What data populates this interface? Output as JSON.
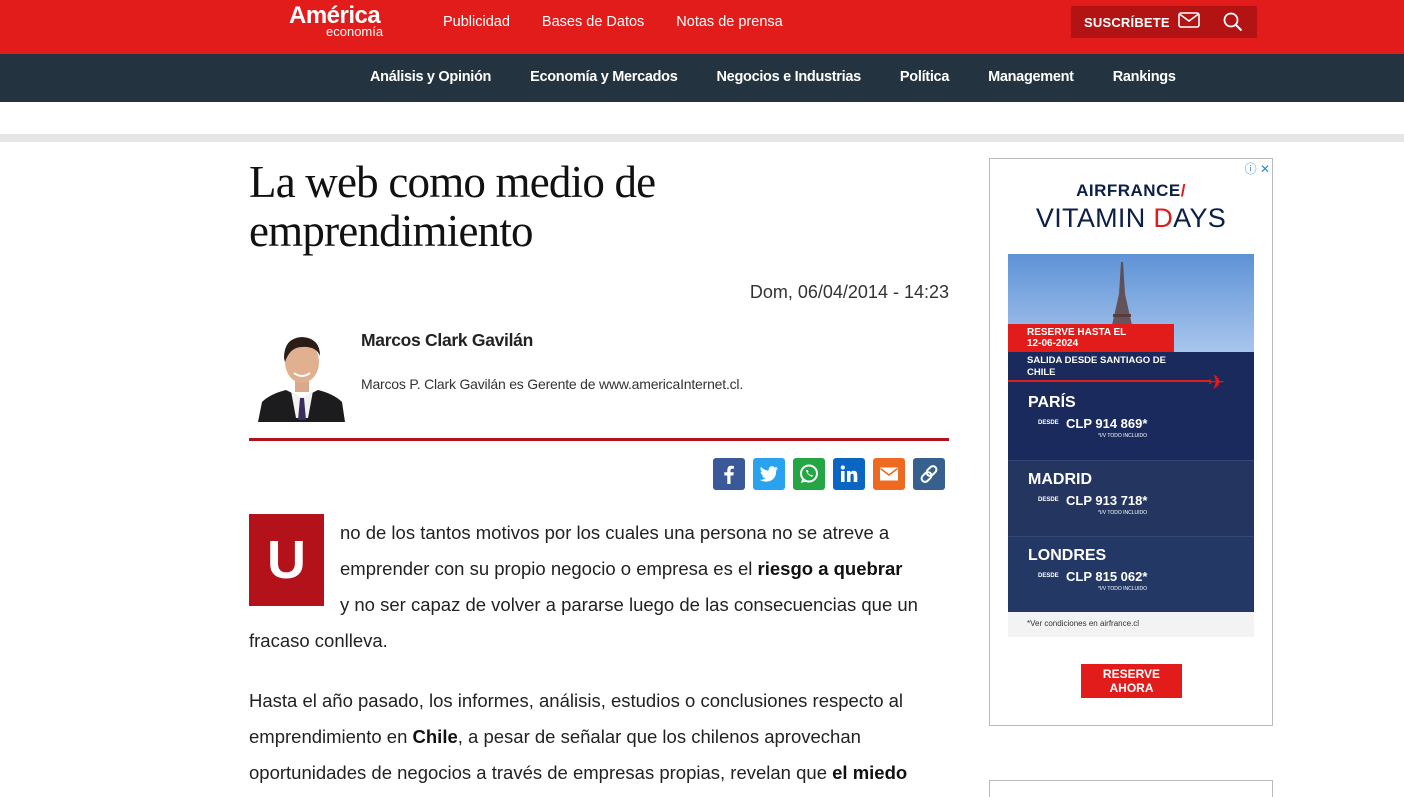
{
  "site": {
    "logo_top": "América",
    "logo_bottom": "economía"
  },
  "toplinks": [
    "Publicidad",
    "Bases de Datos",
    "Notas de prensa"
  ],
  "subscribe": {
    "label": "SUSCRÍBETE"
  },
  "nav": [
    "Análisis y Opinión",
    "Economía y Mercados",
    "Negocios e Industrias",
    "Política",
    "Management",
    "Rankings"
  ],
  "article": {
    "title": "La web como medio de emprendimiento",
    "date": "Dom, 06/04/2014 - 14:23",
    "author_name": "Marcos Clark Gavilán",
    "author_bio": "Marcos P. Clark Gavilán es Gerente de www.americaInternet.cl.",
    "dropcap": "U",
    "p1": {
      "l1": "no de los tantos motivos por los cuales una persona no se atreve a",
      "l2a": "emprender con su propio negocio o empresa es el ",
      "l2b": "riesgo a quebrar",
      "l3": "y no ser capaz de volver a pararse luego de las consecuencias que un",
      "l4": "fracaso conlleva."
    },
    "p2": {
      "l1": "Hasta el año pasado, los informes, análisis, estudios o conclusiones respecto al",
      "l2a": "emprendimiento en ",
      "l2b": "Chile",
      "l2c": ", a pesar de señalar que los chilenos aprovechan",
      "l3a": "oportunidades de negocios a través de empresas propias, revelan que ",
      "l3b": "el miedo"
    }
  },
  "share": [
    "facebook-icon",
    "twitter-icon",
    "whatsapp-icon",
    "linkedin-icon",
    "email-icon",
    "link-icon"
  ],
  "ad": {
    "brand": "AIRFRANCE",
    "brand_mark": "/",
    "headline_a": "VITAMIN ",
    "headline_b": "D",
    "headline_c": "AYS",
    "reserve_l1": "RESERVE HASTA EL",
    "reserve_l2": "12-06-2024",
    "salida_l1": "SALIDA DESDE SANTIAGO DE",
    "salida_l2": "CHILE",
    "desde": "DESDE",
    "iva": "*I/V TODO INCLUIDO",
    "cities": [
      {
        "name": "PARÍS",
        "price": "CLP 914 869*"
      },
      {
        "name": "MADRID",
        "price": "CLP 913 718*"
      },
      {
        "name": "LONDRES",
        "price": "CLP 815 062*"
      }
    ],
    "conditions": "*Ver condiciones en airfrance.cl",
    "cta_l1": "RESERVE",
    "cta_l2": "AHORA",
    "colors": {
      "brand_red": "#e21b1b",
      "navy": "#1b2a5c"
    }
  }
}
